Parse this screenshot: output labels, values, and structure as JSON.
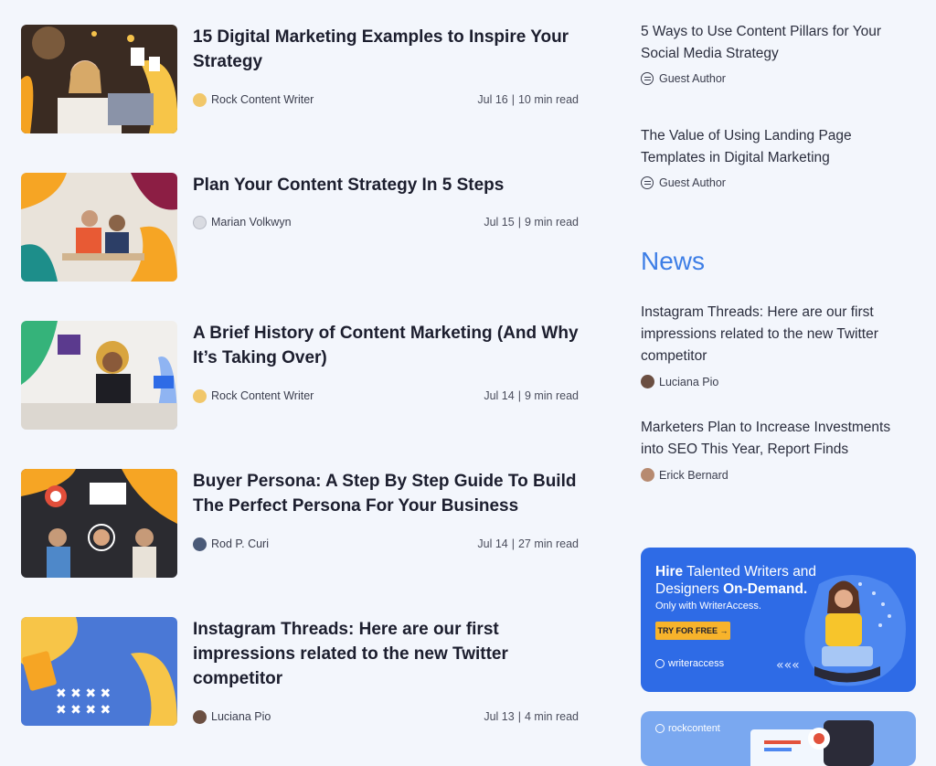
{
  "articles": [
    {
      "title": "15 Digital Marketing Examples to Inspire Your Strategy",
      "author": "Rock Content Writer",
      "date": "Jul 16",
      "read_time": "10 min read"
    },
    {
      "title": "Plan Your Content Strategy In 5 Steps",
      "author": "Marian Volkwyn",
      "date": "Jul 15",
      "read_time": "9 min read"
    },
    {
      "title": "A Brief History of Content Marketing (And Why It’s Taking Over)",
      "author": "Rock Content Writer",
      "date": "Jul 14",
      "read_time": "9 min read"
    },
    {
      "title": "Buyer Persona: A Step By Step Guide To Build The Perfect Persona For Your Business",
      "author": "Rod P. Curi",
      "date": "Jul 14",
      "read_time": "27 min read"
    },
    {
      "title": "Instagram Threads: Here are our first impressions related to the new Twitter competitor",
      "author": "Luciana Pio",
      "date": "Jul 13",
      "read_time": "4 min read"
    }
  ],
  "separator": "|",
  "sidebar": {
    "featured": [
      {
        "title": "5 Ways to Use Content Pillars for Your Social Media Strategy",
        "author": "Guest Author"
      },
      {
        "title": "The Value of Using Landing Page Templates in Digital Marketing",
        "author": "Guest Author"
      }
    ],
    "news_heading": "News",
    "news": [
      {
        "title": "Instagram Threads: Here are our first impressions related to the new Twitter competitor",
        "author": "Luciana Pio"
      },
      {
        "title": "Marketers Plan to Increase Investments into SEO This Year, Report Finds",
        "author": "Erick Bernard"
      }
    ]
  },
  "promo": {
    "headline_1": "Hire",
    "headline_2": " Talented Writers and Designers ",
    "headline_3": "On-Demand.",
    "subline": "Only with WriterAccess.",
    "cta": "TRY FOR FREE →",
    "brand": "writeraccess"
  },
  "promo2": {
    "brand": "rockcontent"
  },
  "colors": {
    "accent": "#3d7ee6",
    "promo_bg": "#2e6be6",
    "cta": "#f7b32b",
    "page_bg": "#f3f6fc"
  }
}
